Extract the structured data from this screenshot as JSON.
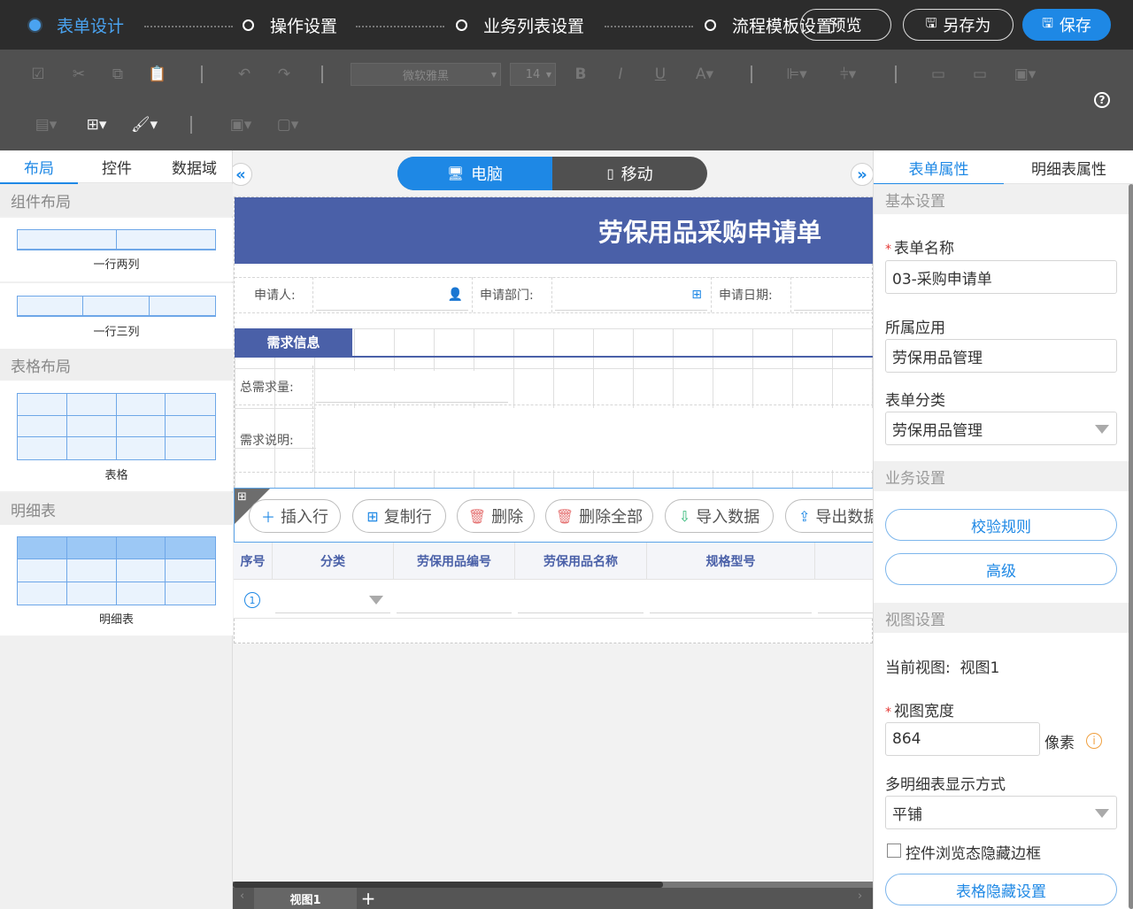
{
  "steps": [
    {
      "label": "表单设计",
      "active": true
    },
    {
      "label": "操作设置",
      "active": false
    },
    {
      "label": "业务列表设置",
      "active": false
    },
    {
      "label": "流程模板设置",
      "active": false
    }
  ],
  "top_buttons": {
    "preview": "预览",
    "save_as": "另存为",
    "save": "保存"
  },
  "toolbar": {
    "font_family": "微软雅黑",
    "font_size": "14",
    "help": "?"
  },
  "left_panel": {
    "tabs": [
      "布局",
      "控件",
      "数据域"
    ],
    "sections": {
      "component_layout": "组件布局",
      "table_layout": "表格布局",
      "detail_table": "明细表"
    },
    "items": {
      "one_row_two_cols": "一行两列",
      "one_row_three_cols": "一行三列",
      "table": "表格",
      "detail": "明细表"
    }
  },
  "canvas": {
    "view_toggle": {
      "desktop": "电脑",
      "mobile": "移动"
    },
    "form_title": "劳保用品采购申请单",
    "fields": {
      "applicant": "申请人:",
      "department": "申请部门:",
      "apply_date": "申请日期:",
      "total_qty": "总需求量:",
      "description": "需求说明:"
    },
    "section_tag": "需求信息",
    "detail_buttons": [
      "插入行",
      "复制行",
      "删除",
      "删除全部",
      "导入数据",
      "导出数据"
    ],
    "detail_columns": [
      "序号",
      "分类",
      "劳保用品编号",
      "劳保用品名称",
      "规格型号"
    ],
    "row_number": "1",
    "view_tab": "视图1"
  },
  "right_panel": {
    "tabs": [
      "表单属性",
      "明细表属性"
    ],
    "basic_section": "基本设置",
    "form_name_label": "表单名称",
    "form_name_value": "03-采购申请单",
    "app_label": "所属应用",
    "app_value": "劳保用品管理",
    "category_label": "表单分类",
    "category_value": "劳保用品管理",
    "business_section": "业务设置",
    "validate_btn": "校验规则",
    "advanced_btn": "高级",
    "view_section": "视图设置",
    "current_view_label": "当前视图:",
    "current_view_value": "视图1",
    "view_width_label": "视图宽度",
    "view_width_value": "864",
    "unit": "像素",
    "multi_detail_label": "多明细表显示方式",
    "multi_detail_value": "平铺",
    "hide_border_label": "控件浏览态隐藏边框",
    "table_hide_btn": "表格隐藏设置"
  },
  "colors": {
    "accent": "#1e88e5",
    "header_blue": "#4a60a8",
    "topbar": "#2c2c2c",
    "toolbar": "#505050"
  }
}
